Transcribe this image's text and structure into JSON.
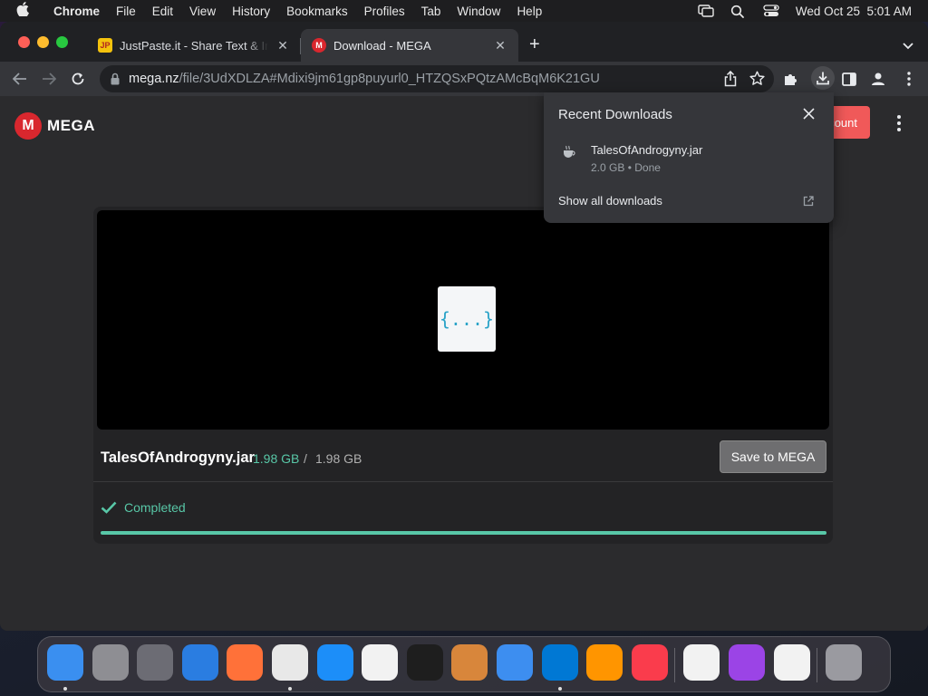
{
  "menubar": {
    "app_name": "Chrome",
    "items": [
      "File",
      "Edit",
      "View",
      "History",
      "Bookmarks",
      "Profiles",
      "Tab",
      "Window",
      "Help"
    ],
    "datetime": "Wed Oct 25  5:01 AM"
  },
  "tabs": [
    {
      "favicon_text": "JP",
      "title": "JustPaste.it - Share Text & Ima",
      "active": false
    },
    {
      "favicon_text": "M",
      "title": "Download - MEGA",
      "active": true
    }
  ],
  "address_bar": {
    "host": "mega.nz",
    "path": "/file/3UdXDLZA#Mdixi9jm61gp8puyurl0_HTZQSxPQtzAMcBqM6K21GU"
  },
  "mega": {
    "logo_letter": "M",
    "logo_text": "MEGA",
    "create_account_label": "Create account",
    "file_thumb_glyph": "{...}",
    "file_name": "TalesOfAndrogyny.jar",
    "size_downloaded": "1.98 GB",
    "size_separator": "/",
    "size_total": "1.98 GB",
    "save_button_label": "Save to MEGA",
    "status_label": "Completed",
    "progress": 1.0,
    "accent_color": "#58c7a7",
    "brand_color": "#d9272e"
  },
  "downloads_bubble": {
    "title": "Recent Downloads",
    "items": [
      {
        "name": "TalesOfAndrogyny.jar",
        "meta": "2.0 GB • Done"
      }
    ],
    "show_all_label": "Show all downloads"
  },
  "dock": {
    "apps": [
      {
        "name": "Finder",
        "color": "#3a8ff0",
        "running": true
      },
      {
        "name": "System Settings",
        "color": "#8e8e93",
        "running": false
      },
      {
        "name": "Launchpad",
        "color": "#6c6c74",
        "running": false
      },
      {
        "name": "Safari",
        "color": "#2a7de1",
        "running": false
      },
      {
        "name": "Firefox",
        "color": "#ff7139",
        "running": false
      },
      {
        "name": "Google Chrome",
        "color": "#e8e8e8",
        "running": true
      },
      {
        "name": "App Store",
        "color": "#1c8ef9",
        "running": false
      },
      {
        "name": "TextEdit",
        "color": "#f2f2f2",
        "running": false
      },
      {
        "name": "Terminal",
        "color": "#1e1e1e",
        "running": false
      },
      {
        "name": "GarageBand",
        "color": "#d8863b",
        "running": false
      },
      {
        "name": "iCloud Weather",
        "color": "#3d8ef0",
        "running": false
      },
      {
        "name": "Visual Studio Code",
        "color": "#0078d4",
        "running": true
      },
      {
        "name": "Books",
        "color": "#ff9500",
        "running": false
      },
      {
        "name": "Music",
        "color": "#fa3c4c",
        "running": false
      },
      {
        "name": "Freeform",
        "color": "#f2f2f2",
        "running": false
      },
      {
        "name": "Podcasts",
        "color": "#9b44e6",
        "running": false
      },
      {
        "name": "News",
        "color": "#f2f2f2",
        "running": false
      },
      {
        "name": "Trash",
        "color": "#9a9aa0",
        "running": false
      }
    ]
  }
}
